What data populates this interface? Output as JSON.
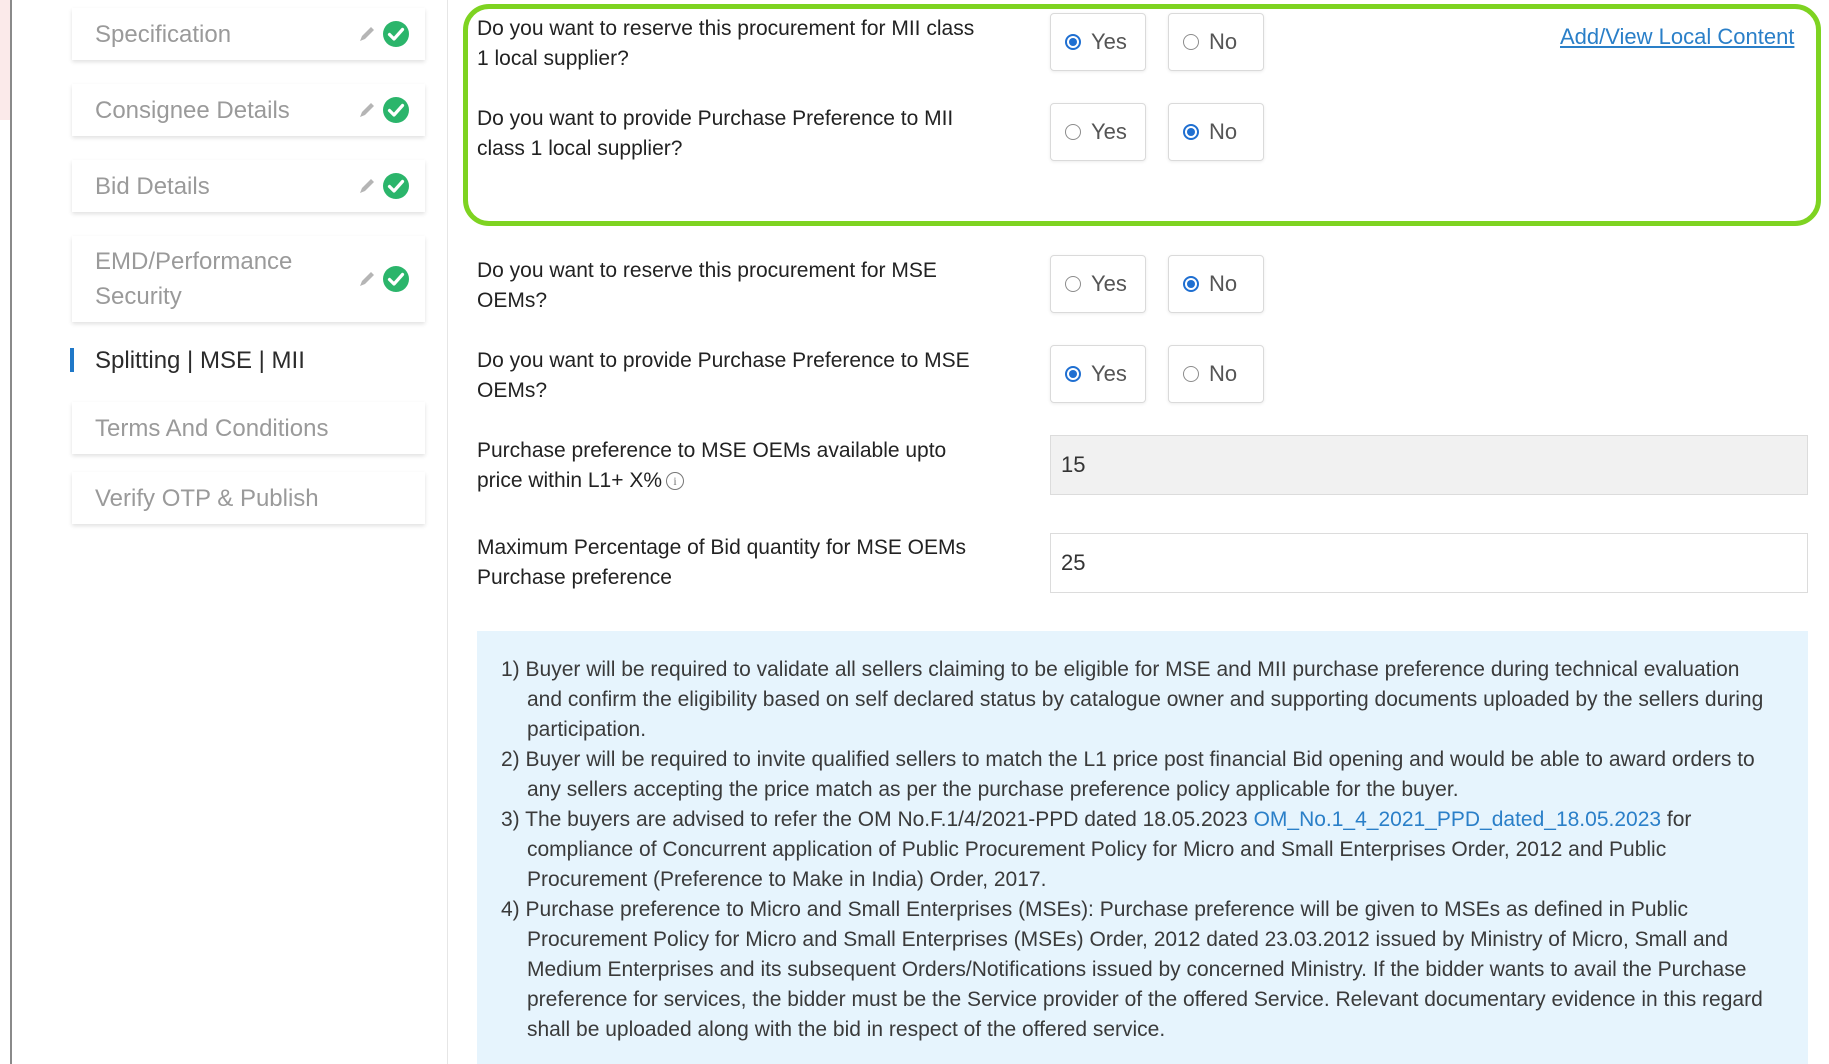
{
  "sidebar": {
    "items": [
      {
        "label": "Specification",
        "state": "done"
      },
      {
        "label": "Consignee Details",
        "state": "done"
      },
      {
        "label": "Bid Details",
        "state": "done"
      },
      {
        "label": "EMD/Performance Security",
        "line1": "EMD/Performance",
        "line2": "Security",
        "state": "done"
      },
      {
        "label": "Splitting | MSE | MII",
        "state": "active"
      },
      {
        "label": "Terms And Conditions",
        "state": "pending"
      },
      {
        "label": "Verify OTP & Publish",
        "state": "pending"
      }
    ]
  },
  "questions": {
    "mii_reserve": {
      "line1": "Do you want to reserve this procurement for MII class",
      "line2": "1 local supplier?",
      "selected": "Yes"
    },
    "mii_preference": {
      "line1": "Do you want to provide Purchase Preference to MII",
      "line2": "class 1 local supplier?",
      "selected": "No"
    },
    "mse_reserve": {
      "line1": "Do you want to reserve this procurement for MSE",
      "line2": "OEMs?",
      "selected": "No"
    },
    "mse_preference": {
      "line1": "Do you want to provide Purchase Preference to MSE",
      "line2": "OEMs?",
      "selected": "Yes"
    }
  },
  "options": {
    "yes": "Yes",
    "no": "No"
  },
  "local_content_link": "Add/View Local Content",
  "price_preference": {
    "line1": "Purchase preference to MSE OEMs available upto",
    "line2": "price within L1+ X%",
    "value": "15"
  },
  "quantity_preference": {
    "line1": "Maximum Percentage of Bid quantity for MSE OEMs",
    "line2": "Purchase preference",
    "value": "25"
  },
  "notes": {
    "n1": "1) Buyer will be required to validate all sellers claiming to be eligible for MSE and MII purchase preference during technical evaluation and confirm the eligibility based on self declared status by catalogue owner and supporting documents uploaded by the sellers during participation.",
    "n2": "2) Buyer will be required to invite qualified sellers to match the L1 price post financial Bid opening and would be able to award orders to any sellers accepting the price match as per the purchase preference policy applicable for the buyer.",
    "n3_before": "3) The buyers are advised to refer the OM No.F.1/4/2021-PPD dated 18.05.2023 ",
    "n3_link": "OM_No.1_4_2021_PPD_dated_18.05.2023",
    "n3_after": " for compliance of Concurrent application of Public Procurement Policy for Micro and Small Enterprises Order, 2012 and Public Procurement (Preference to Make in India) Order, 2017.",
    "n4": "4) Purchase preference to Micro and Small Enterprises (MSEs): Purchase preference will be given to MSEs as defined in Public Procurement Policy for Micro and Small Enterprises (MSEs) Order, 2012 dated 23.03.2012 issued by Ministry of Micro, Small and Medium Enterprises and its subsequent Orders/Notifications issued by concerned Ministry. If the bidder wants to avail the Purchase preference for services, the bidder must be the Service provider of the offered Service. Relevant documentary evidence in this regard shall be uploaded along with the bid in respect of the offered service."
  },
  "colors": {
    "highlight": "#7ed321",
    "accent": "#1f6fd1",
    "success": "#2bb56b",
    "link": "#2a7fc8",
    "notes_bg": "#e6f4fd"
  }
}
